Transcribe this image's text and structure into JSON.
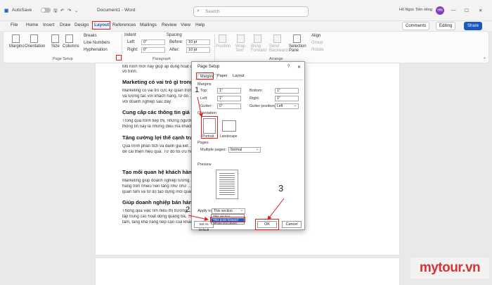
{
  "titlebar": {
    "autosave": "AutoSave",
    "toggle": "Off",
    "doc_title": "Document1 - Word",
    "search_placeholder": "Search",
    "user": "Hồ Ngọc Tiền riêng",
    "avatar": "HN"
  },
  "menu": {
    "tabs": [
      "File",
      "Home",
      "Insert",
      "Draw",
      "Design",
      "Layout",
      "References",
      "Mailings",
      "Review",
      "View",
      "Help"
    ],
    "comments": "Comments",
    "editing": "Editing",
    "share": "Share"
  },
  "ribbon": {
    "margins": "Margins",
    "orientation": "Orientation",
    "size": "Size",
    "columns": "Columns",
    "breaks": "Breaks",
    "line_numbers": "Line Numbers",
    "hyphenation": "Hyphenation",
    "page_setup": "Page Setup",
    "indent": "Indent",
    "left": "Left:",
    "right": "Right:",
    "indent_left_val": "0\"",
    "indent_right_val": "0\"",
    "spacing": "Spacing",
    "before": "Before:",
    "after": "After:",
    "before_val": "10 pt",
    "after_val": "10 pt",
    "paragraph": "Paragraph",
    "position": "Position",
    "wrap_text": "Wrap Text",
    "bring_forward": "Bring Forward",
    "send_backward": "Send Backward",
    "selection_pane": "Selection Pane",
    "align": "Align",
    "group": "Group",
    "rotate": "Rotate",
    "arrange": "Arrange"
  },
  "document": {
    "lines": [
      "Mô hình mới này giúp áp dụng hoạt động ... mô hình mà còn là những dịch vụ",
      "vô hình.",
      "Marketing có vai trò gì trong ...",
      "Marketing có vai trò cực kỳ quan trọng ... giúp doanh nghiệp có thể tiếp cận",
      "và tương tác với khách hàng, từ đó ... khác các vai trò của marketing đối",
      "với doanh nghiệp sau đây:",
      "Cung cấp các thông tin giá trị ...",
      "Trong quá trình tiếp thị, những người ... tiết về sản phẩm/ dịch vụ. Những",
      "thông tin này là những điều mà khách ... khách hàng tình huống khuyến mại...",
      "Tăng cường lợi thế cạnh tranh ...",
      "Quá trình phân tích và đánh giá kết ... ra những điều chỉnh và cải tiến",
      "để cải thiện hiệu quả. Từ đó tối ưu hóa ... thị trường.",
      "Tạo mối quan hệ khách hàng ...",
      "Marketing giúp doanh nghiệp tương ... nhanh chóng, linh hoạt với khách",
      "hàng trên nhiều nền tảng như như ... y giúp khách hàng cảm thấy được",
      "quan tâm và từ đó tạo dựng mối quan hệ ...",
      "Giúp doanh nghiệp bán hàng ...",
      "Thông qua việc tìm hiểu thị trường, ... hàng. Điều này giúp doanh nghiệp",
      "tập trung các hoạt động quảng bá, ... hoạt động này giúp thu hút sự quan",
      "tâm, tăng khả năng tiếp cận của khách ..."
    ]
  },
  "dialog": {
    "title": "Page Setup",
    "help": "?",
    "close": "✕",
    "tabs": [
      "Margins",
      "Paper",
      "Layout"
    ],
    "margins_section": "Margins",
    "top": "Top:",
    "bottom": "Bottom:",
    "left": "Left:",
    "right": "Right:",
    "gutter": "Gutter:",
    "gutter_position": "Gutter position:",
    "val_top": "1\"",
    "val_bottom": "1\"",
    "val_left": "1\"",
    "val_right": "1\"",
    "val_gutter": "0\"",
    "val_gutter_pos": "Left",
    "orientation_section": "Orientation",
    "portrait": "Portrait",
    "landscape": "Landscape",
    "pages_section": "Pages",
    "multiple_pages": "Multiple pages:",
    "multiple_pages_val": "Normal",
    "preview_section": "Preview",
    "apply_to": "Apply to:",
    "apply_val": "This section",
    "apply_options": [
      "This section",
      "This point forward",
      "Whole document"
    ],
    "set_default": "Set As Default",
    "ok": "OK",
    "cancel": "Cancel"
  },
  "annotations": {
    "step1": "1",
    "step2": "2",
    "step3": "3",
    "accent": "#e31c1c"
  },
  "watermark": "mytour.vn"
}
